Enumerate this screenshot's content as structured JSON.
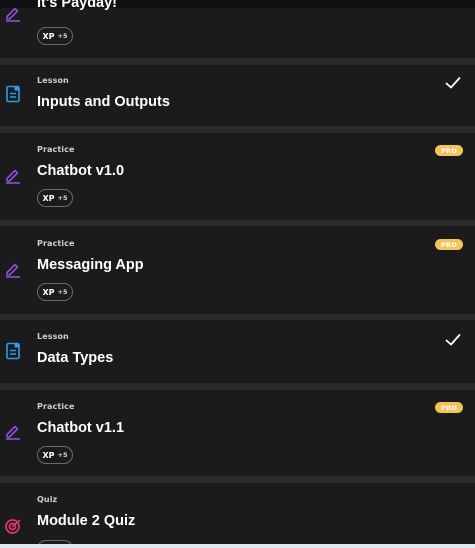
{
  "items": [
    {
      "kind": "",
      "title": "It's Payday!",
      "type": "practice",
      "xp_label": "XP",
      "xp_value": "+5",
      "completed": false,
      "pro": false
    },
    {
      "kind": "Lesson",
      "title": "Inputs and Outputs",
      "type": "lesson",
      "completed": true,
      "pro": false
    },
    {
      "kind": "Practice",
      "title": "Chatbot v1.0",
      "type": "practice",
      "xp_label": "XP",
      "xp_value": "+5",
      "completed": false,
      "pro": true,
      "pro_label": "PRO"
    },
    {
      "kind": "Practice",
      "title": "Messaging App",
      "type": "practice",
      "xp_label": "XP",
      "xp_value": "+5",
      "completed": false,
      "pro": true,
      "pro_label": "PRO"
    },
    {
      "kind": "Lesson",
      "title": "Data Types",
      "type": "lesson",
      "completed": true,
      "pro": false
    },
    {
      "kind": "Practice",
      "title": "Chatbot v1.1",
      "type": "practice",
      "xp_label": "XP",
      "xp_value": "+5",
      "completed": false,
      "pro": true,
      "pro_label": "PRO"
    },
    {
      "kind": "Quiz",
      "title": "Module 2 Quiz",
      "type": "quiz",
      "completed": false,
      "pro": false
    }
  ],
  "colors": {
    "practice_icon": "#8b4fd8",
    "lesson_icon": "#2d9cf0",
    "quiz_icon": "#e8336b",
    "pro_badge": "#f4c35a",
    "card_bg": "#1b1b1b",
    "gap_bg": "#2a2a2a"
  },
  "icons": {
    "practice": "pencil-icon",
    "lesson": "document-icon",
    "quiz": "target-icon",
    "completed": "check-icon"
  }
}
